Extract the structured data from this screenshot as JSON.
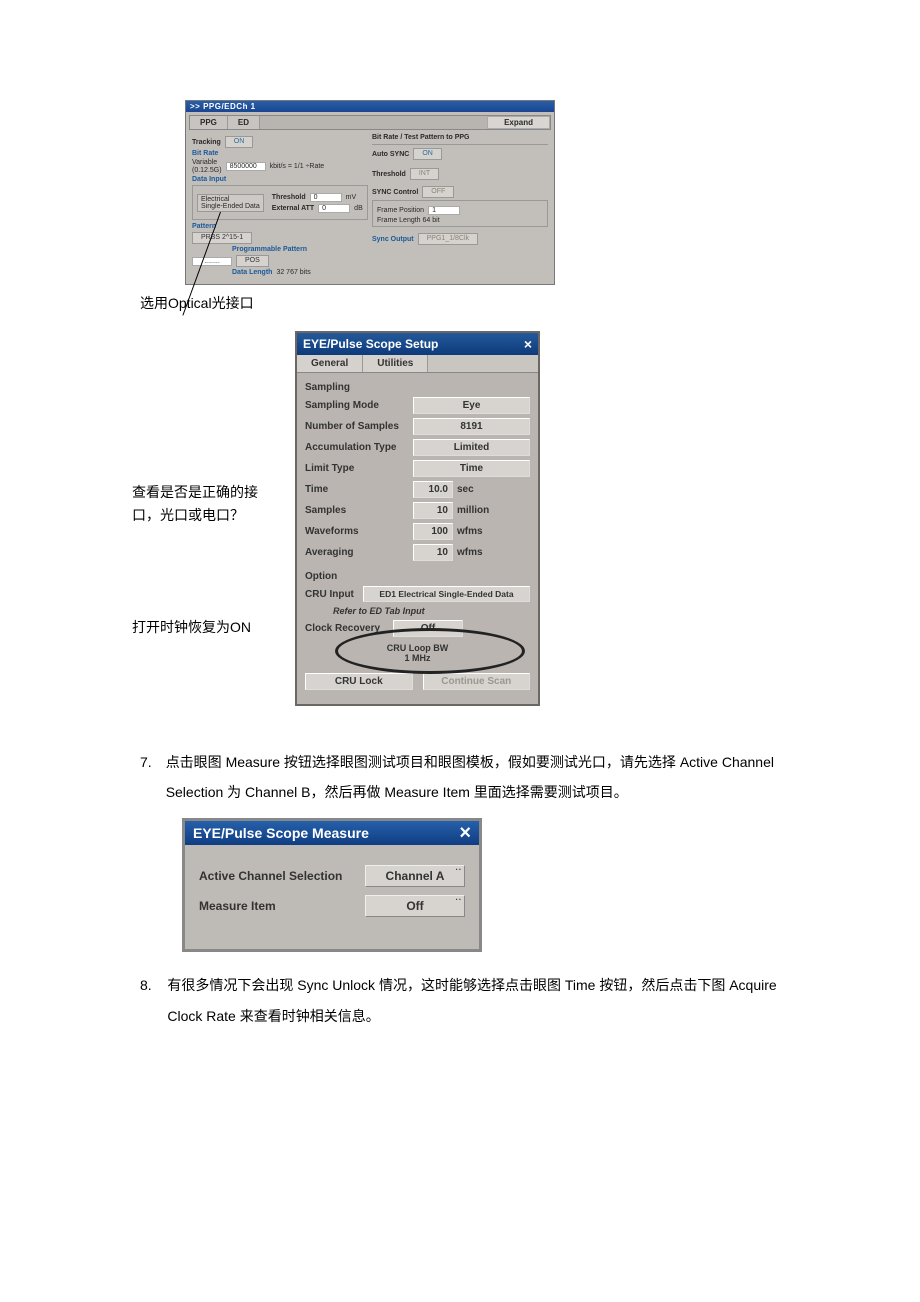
{
  "panel1": {
    "title": ">> PPG/EDCh 1",
    "tabs": {
      "ppg": "PPG",
      "ed": "ED",
      "expand": "Expand"
    },
    "left": {
      "tracking_label": "Tracking",
      "tracking_btn": "ON",
      "bitrate_header": "Bit Rate",
      "bitrate_sub1": "Variable",
      "bitrate_sub2": "(0.12.5G)",
      "bitrate_val": "8500000",
      "bitrate_unit": "kbit/s = 1/1 ÷Rate",
      "datainput_header": "Data Input",
      "datainput_line1": "Electrical",
      "datainput_line2": "Single-Ended Data",
      "threshold_label": "Threshold",
      "threshold_val": "0",
      "threshold_unit": "mV",
      "extatt_label": "External ATT",
      "extatt_val": "0",
      "extatt_unit": "dB",
      "pattern_header": "Pattern",
      "pattern_val": "PRBS 2^15-1",
      "prog_pat": "Programmable Pattern",
      "prog_slot": "........",
      "pos_btn": "POS",
      "datalen_label": "Data Length",
      "datalen_val": "32 767 bits"
    },
    "right": {
      "bitrate_to_ppg": "Bit Rate / Test Pattern to PPG",
      "autosync_label": "Auto SYNC",
      "autosync_btn": "ON",
      "threshold_label": "Threshold",
      "threshold_btn": "INT",
      "syncctrl_label": "SYNC Control",
      "syncctrl_btn": "OFF",
      "framepos_label": "Frame Position",
      "framepos_val": "1",
      "framelen_label": "Frame Length 64 bit",
      "syncout_label": "Sync Output",
      "syncout_btn": "PPG1_1/8Clk"
    }
  },
  "caption1": "选用Optical光接口",
  "side_notes": {
    "note1": "查看是否是正确的接口，光口或电口？",
    "note2": "打开时钟恢复为ON"
  },
  "panel2": {
    "title": "EYE/Pulse Scope Setup",
    "tabs": {
      "general": "General",
      "utilities": "Utilities"
    },
    "sampling_header": "Sampling",
    "rows": {
      "sampling_mode_l": "Sampling Mode",
      "sampling_mode_v": "Eye",
      "num_samples_l": "Number of Samples",
      "num_samples_v": "8191",
      "accum_l": "Accumulation Type",
      "accum_v": "Limited",
      "limit_l": "Limit Type",
      "limit_v": "Time",
      "time_l": "Time",
      "time_v": "10.0",
      "time_u": "sec",
      "samples_l": "Samples",
      "samples_v": "10",
      "samples_u": "million",
      "wave_l": "Waveforms",
      "wave_v": "100",
      "wave_u": "wfms",
      "avg_l": "Averaging",
      "avg_v": "10",
      "avg_u": "wfms"
    },
    "option_header": "Option",
    "cru_input_l": "CRU Input",
    "cru_input_v": "ED1 Electrical Single-Ended Data",
    "refer_note": "Refer to ED Tab Input",
    "clock_rec_l": "Clock Recovery",
    "clock_rec_v": "Off",
    "loop_bw_l": "CRU Loop BW",
    "loop_bw_v": "1 MHz",
    "cru_lock": "CRU Lock",
    "cont_scan": "Continue Scan"
  },
  "text_item7": "点击眼图 Measure 按钮选择眼图测试项目和眼图模板，假如要测试光口，请先选择 Active Channel Selection 为 Channel B，然后再做 Measure Item 里面选择需要测试项目。",
  "panel3": {
    "title": "EYE/Pulse Scope Measure",
    "acs_l": "Active Channel Selection",
    "acs_v": "Channel A",
    "mi_l": "Measure Item",
    "mi_v": "Off"
  },
  "text_item8": "有很多情况下会出现 Sync Unlock 情况，这时能够选择点击眼图 Time 按钮，然后点击下图 Acquire Clock Rate 来查看时钟相关信息。"
}
